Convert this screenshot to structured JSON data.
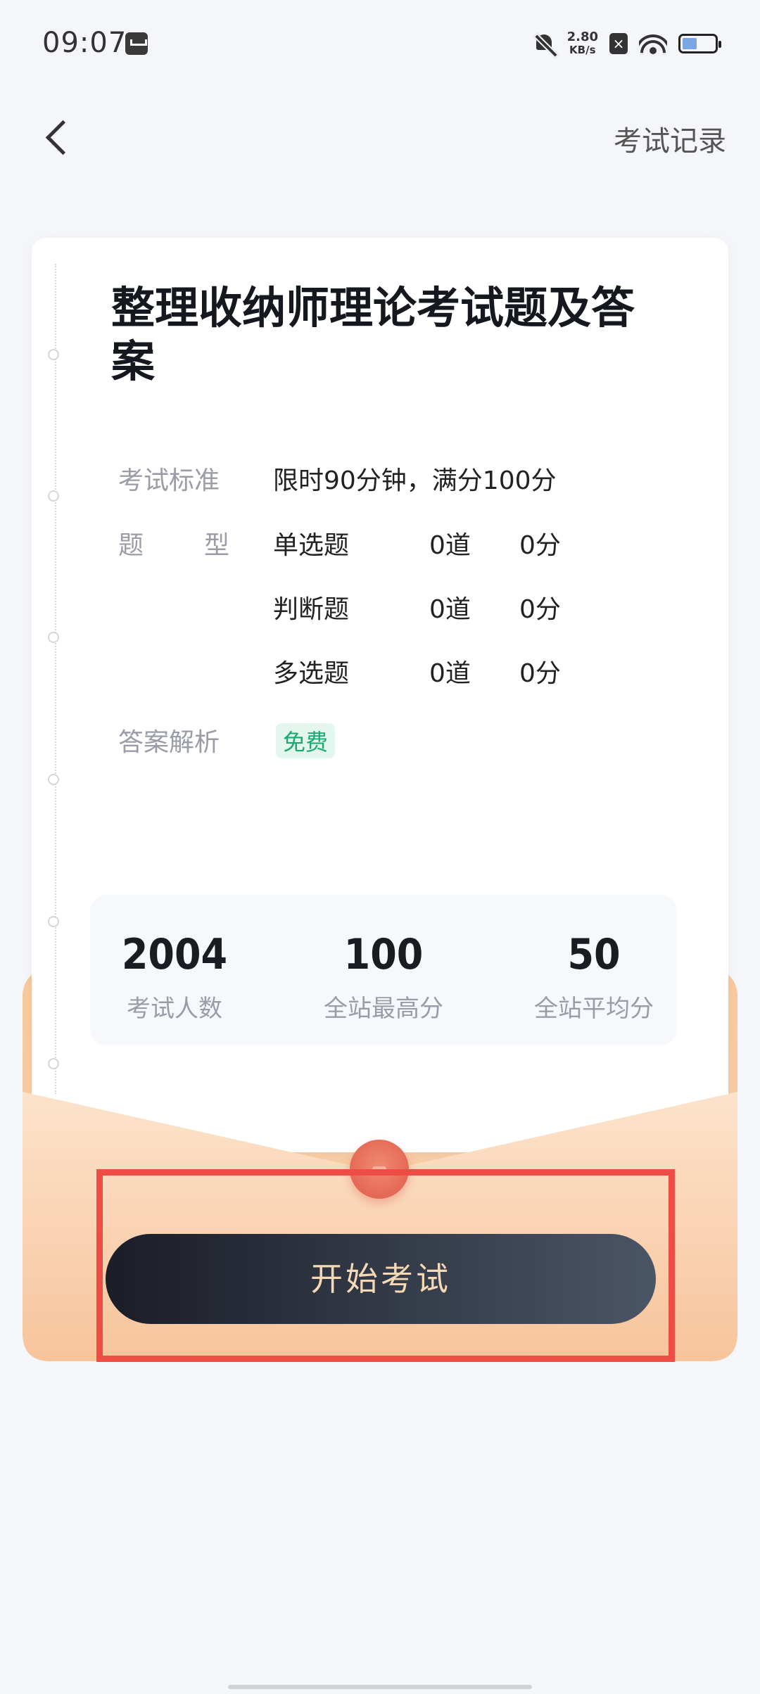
{
  "status_bar": {
    "time": "09:07",
    "net_speed_value": "2.80",
    "net_speed_unit": "KB/s",
    "x_label": "×"
  },
  "nav": {
    "record_label": "考试记录"
  },
  "exam": {
    "title": "整理收纳师理论考试题及答案",
    "standard_label": "考试标准",
    "standard_value": "限时90分钟，满分100分",
    "type_label_1": "题",
    "type_label_2": "型",
    "question_types": [
      {
        "name": "单选题",
        "count": "0道",
        "score": "0分"
      },
      {
        "name": "判断题",
        "count": "0道",
        "score": "0分"
      },
      {
        "name": "多选题",
        "count": "0道",
        "score": "0分"
      }
    ],
    "analysis_label": "答案解析",
    "analysis_badge": "免费"
  },
  "stats": [
    {
      "value": "2004",
      "label": "考试人数"
    },
    {
      "value": "100",
      "label": "全站最高分"
    },
    {
      "value": "50",
      "label": "全站平均分"
    }
  ],
  "start_button_label": "开始考试",
  "colors": {
    "accent_highlight": "#ee4d45",
    "button_text": "#f5d9b5",
    "badge_text": "#1aa874",
    "envelope": "#f8c99d"
  }
}
